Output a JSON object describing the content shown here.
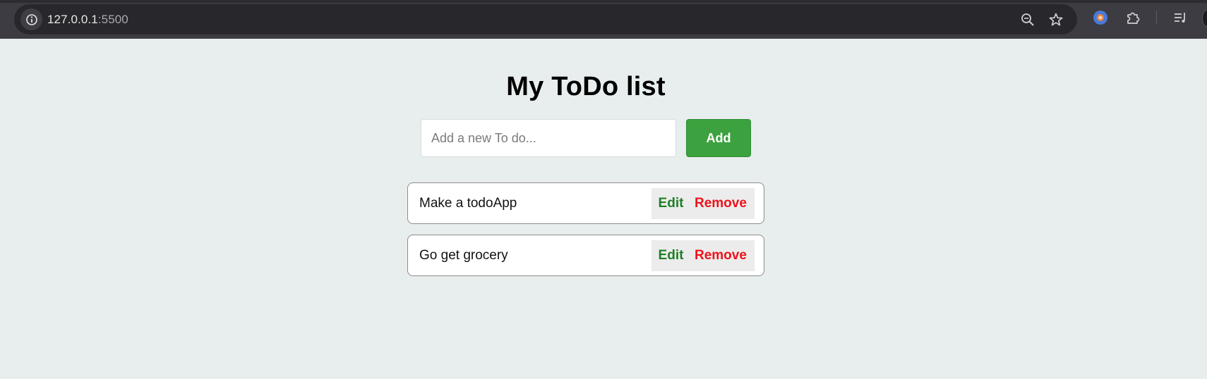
{
  "browser": {
    "url_host": "127.0.0.1",
    "url_port": ":5500",
    "icons": [
      "info-icon",
      "zoom-out-icon",
      "bookmark-star-icon",
      "extension-profile-icon",
      "extensions-puzzle-icon",
      "reading-list-icon"
    ]
  },
  "app": {
    "title": "My ToDo list",
    "input_placeholder": "Add a new To do...",
    "input_value": "",
    "add_label": "Add",
    "colors": {
      "add": "#3ca13f",
      "edit": "#1d7f25",
      "remove": "#f0121b",
      "background": "#e8eeee"
    }
  },
  "todos": [
    {
      "text": "Make a todoApp",
      "edit_label": "Edit",
      "remove_label": "Remove"
    },
    {
      "text": "Go get grocery",
      "edit_label": "Edit",
      "remove_label": "Remove"
    }
  ]
}
